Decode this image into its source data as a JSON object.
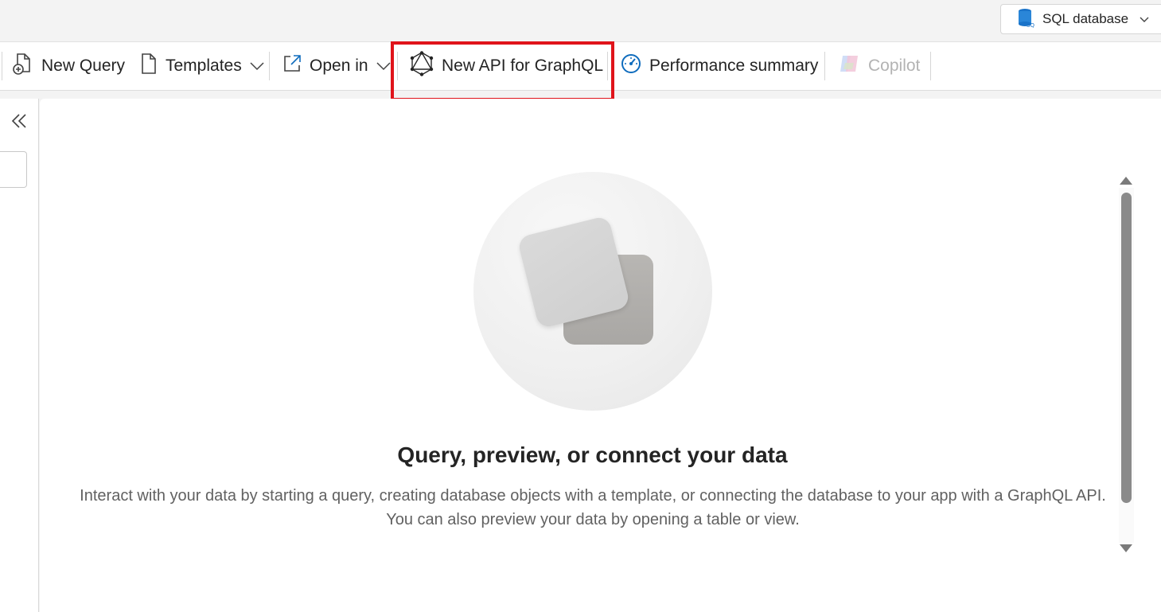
{
  "topbar": {
    "db_selector_label": "SQL database"
  },
  "ribbon": {
    "new_query": "New Query",
    "templates": "Templates",
    "open_in": "Open in",
    "new_api_graphql": "New API for GraphQL",
    "performance_summary": "Performance summary",
    "copilot": "Copilot"
  },
  "empty_state": {
    "heading": "Query, preview, or connect your data",
    "description": "Interact with your data by starting a query, creating database objects with a template, or connecting the database to your app with a GraphQL API. You can also preview your data by opening a table or view."
  },
  "colors": {
    "highlight": "#e0141b",
    "accent": "#0f6cbd"
  },
  "icons": {
    "db": "database-icon",
    "new_query": "new-query-icon",
    "templates": "document-icon",
    "open_in": "open-external-icon",
    "graphql": "graphql-icon",
    "performance": "gauge-icon",
    "copilot": "copilot-icon",
    "collapse": "double-chevron-left-icon"
  }
}
